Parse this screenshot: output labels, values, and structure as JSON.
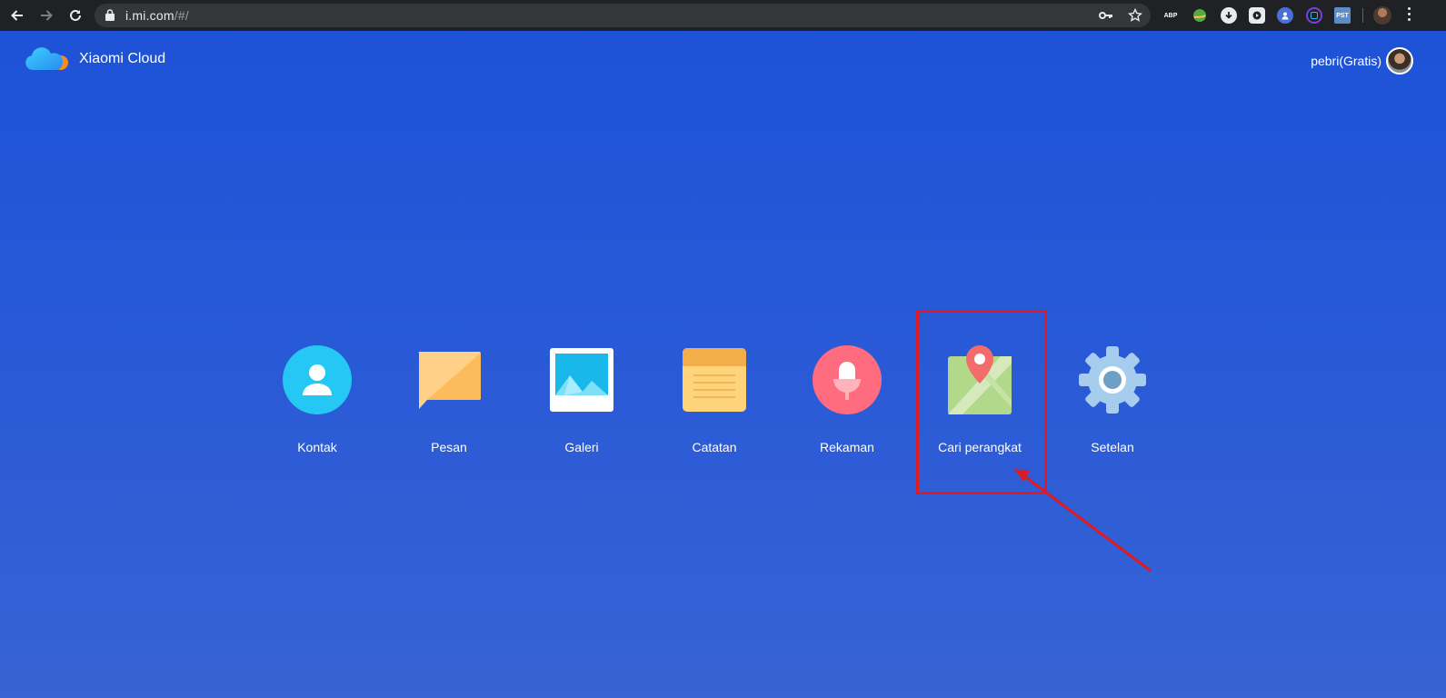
{
  "browser": {
    "url_host": "i.mi.com",
    "url_path": "/#/",
    "extensions": [
      {
        "name": "adblock-plus-icon",
        "label": "ABP",
        "color": "#c4151b"
      },
      {
        "name": "extension-globe-icon",
        "label": "",
        "color": "#5aa646"
      },
      {
        "name": "download-extension-icon",
        "label": "",
        "color": "#e8eaed"
      },
      {
        "name": "video-extension-icon",
        "label": "",
        "color": "#e8eaed"
      },
      {
        "name": "user-extension-icon",
        "label": "",
        "color": "#4a6fd8"
      },
      {
        "name": "circle-extension-icon",
        "label": "",
        "color": "#7a3fe0"
      },
      {
        "name": "pst-extension-icon",
        "label": "PST",
        "color": "#5d8cc9"
      }
    ]
  },
  "header": {
    "title": "Xiaomi Cloud",
    "user": "pebri(Gratis)"
  },
  "apps": [
    {
      "label": "Kontak",
      "icon": "contacts-icon"
    },
    {
      "label": "Pesan",
      "icon": "messages-icon"
    },
    {
      "label": "Galeri",
      "icon": "gallery-icon"
    },
    {
      "label": "Catatan",
      "icon": "notes-icon"
    },
    {
      "label": "Rekaman",
      "icon": "recorder-icon"
    },
    {
      "label": "Cari perangkat",
      "icon": "find-device-icon"
    },
    {
      "label": "Setelan",
      "icon": "settings-icon"
    }
  ],
  "colors": {
    "background_top": "#1c52d8",
    "background_bottom": "#3763d4",
    "annotation": "#e01a22"
  }
}
